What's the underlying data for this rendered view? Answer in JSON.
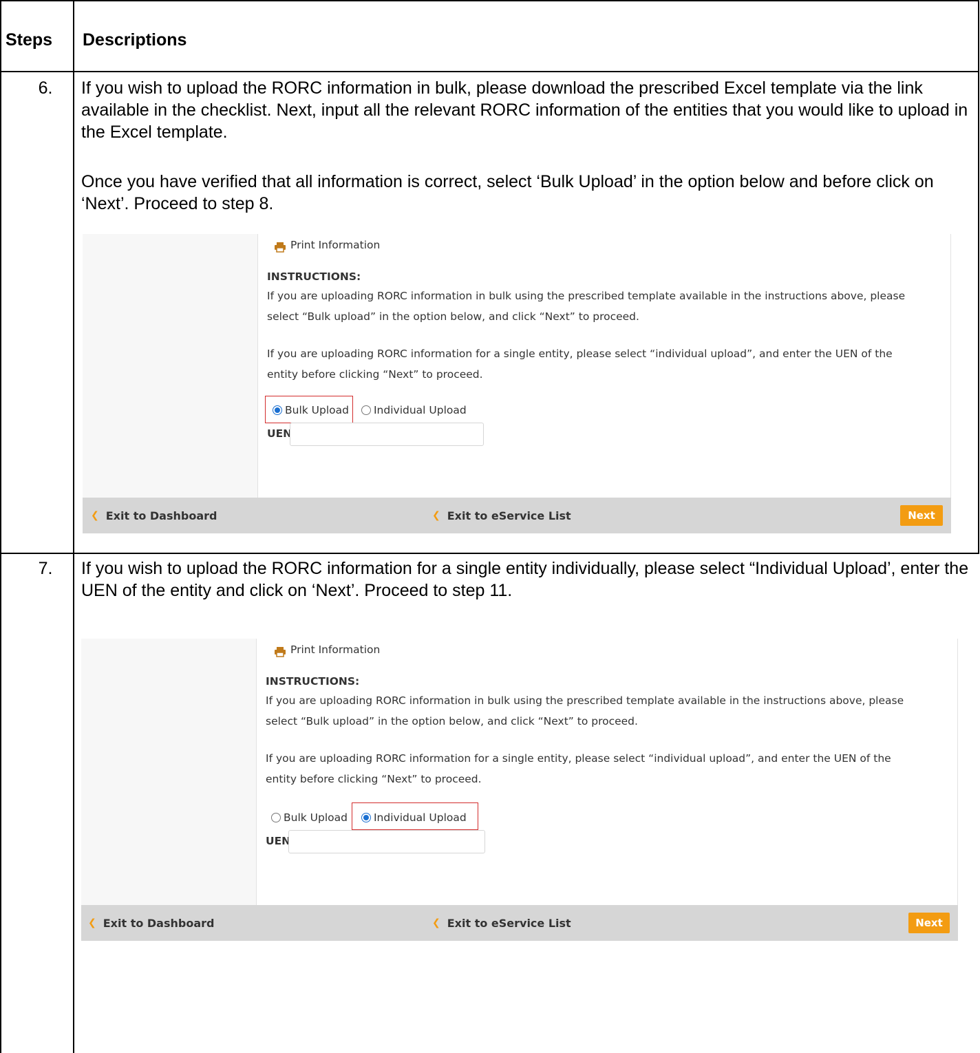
{
  "table": {
    "header_steps": "Steps",
    "header_descriptions": "Descriptions"
  },
  "rows": [
    {
      "step": "6.",
      "para1": "If you wish to upload the RORC information in bulk, please download the prescribed Excel template via the link available in the checklist. Next, input all the relevant RORC information of the entities that you would like to upload in the Excel template.",
      "para2": "Once you have verified that all information is correct, select ‘Bulk Upload’ in the option below and before click on ‘Next’. Proceed to step 8.",
      "screenshot": {
        "print_label": "Print Information",
        "instructions_title": "INSTRUCTIONS:",
        "instr1_line1": "If you are uploading RORC information in bulk using the prescribed template available in the instructions above, please",
        "instr1_line2": "select “Bulk upload” in the option below, and click “Next” to proceed.",
        "instr2_line1": "If you are uploading RORC information for a single entity, please select “individual upload”, and enter the UEN of the",
        "instr2_line2": "entity before clicking “Next” to proceed.",
        "option_bulk": "Bulk Upload",
        "option_individual": "Individual Upload",
        "selected": "bulk",
        "uen_label": "UEN",
        "uen_value": "",
        "exit_dashboard": "Exit to Dashboard",
        "exit_eservice": "Exit to eService List",
        "next": "Next"
      }
    },
    {
      "step": "7.",
      "para1": "If you wish to upload the RORC information for a single entity individually, please select “Individual Upload’, enter the UEN of the entity and click on ‘Next’. Proceed to step 11.",
      "screenshot": {
        "print_label": "Print Information",
        "instructions_title": "INSTRUCTIONS:",
        "instr1_line1": "If you are uploading RORC information in bulk using the prescribed template available in the instructions above, please",
        "instr1_line2": "select “Bulk upload” in the option below, and click “Next” to proceed.",
        "instr2_line1": "If you are uploading RORC information for a single entity, please select “individual upload”, and enter the UEN of the",
        "instr2_line2": "entity before clicking “Next” to proceed.",
        "option_bulk": "Bulk Upload",
        "option_individual": "Individual Upload",
        "selected": "individual",
        "uen_label": "UEN",
        "uen_value": "",
        "exit_dashboard": "Exit to Dashboard",
        "exit_eservice": "Exit to eService List",
        "next": "Next"
      }
    }
  ],
  "colors": {
    "accent_orange": "#f39c12",
    "link_orange": "#c07a1a",
    "instructions_red": "#e31b23",
    "highlight_box_red": "#d32c2c",
    "radio_blue": "#1a6fd1",
    "footer_grey": "#d6d6d6"
  },
  "icons": {
    "print": "printer-icon",
    "back": "chevron-left-icon"
  }
}
